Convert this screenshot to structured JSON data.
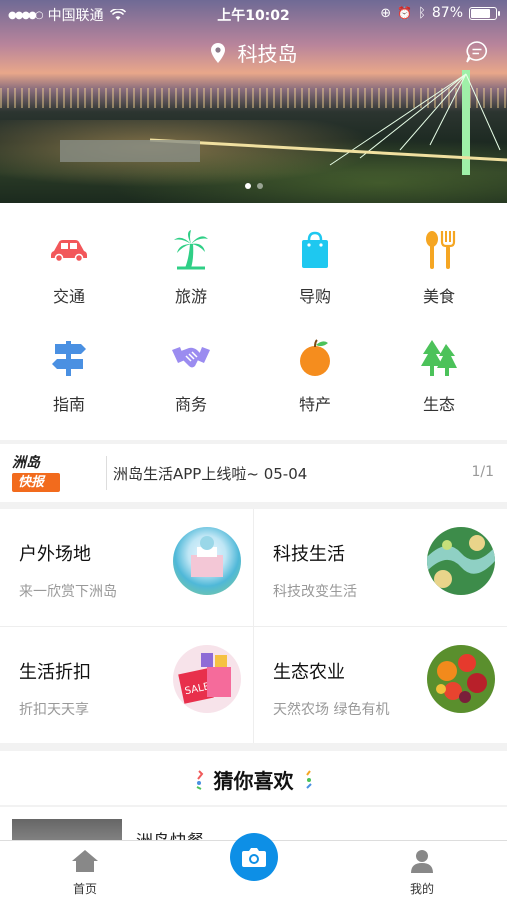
{
  "status_bar": {
    "carrier": "中国联通",
    "time": "上午10:02",
    "battery": "87%",
    "battery_level": 0.87
  },
  "header": {
    "location": "科技岛"
  },
  "banner": {
    "slide_count": 2,
    "active_slide": 1
  },
  "categories": [
    {
      "label": "交通",
      "icon": "car-icon",
      "color": "#f2575a"
    },
    {
      "label": "旅游",
      "icon": "palm-tree-icon",
      "color": "#2fcf86"
    },
    {
      "label": "导购",
      "icon": "shopping-bag-icon",
      "color": "#1ec8f0"
    },
    {
      "label": "美食",
      "icon": "spoon-fork-icon",
      "color": "#f5a623"
    },
    {
      "label": "指南",
      "icon": "signpost-icon",
      "color": "#4a90e2"
    },
    {
      "label": "商务",
      "icon": "handshake-icon",
      "color": "#9b8cf0"
    },
    {
      "label": "特产",
      "icon": "orange-fruit-icon",
      "color": "#f58d1e"
    },
    {
      "label": "生态",
      "icon": "pine-tree-icon",
      "color": "#4cc25a"
    }
  ],
  "news": {
    "logo_top": "洲岛",
    "logo_bottom": "快报",
    "text": "洲岛生活APP上线啦~ 05-04",
    "page": "1/1"
  },
  "cards": [
    {
      "title": "户外场地",
      "subtitle": "来一欣赏下洲岛"
    },
    {
      "title": "科技生活",
      "subtitle": "科技改变生活"
    },
    {
      "title": "生活折扣",
      "subtitle": "折扣天天享"
    },
    {
      "title": "生态农业",
      "subtitle": "天然农场 绿色有机"
    }
  ],
  "guess": {
    "title": "猜你喜欢",
    "first_item": "洲岛快餐"
  },
  "tabbar": {
    "home": "首页",
    "mine": "我的"
  }
}
